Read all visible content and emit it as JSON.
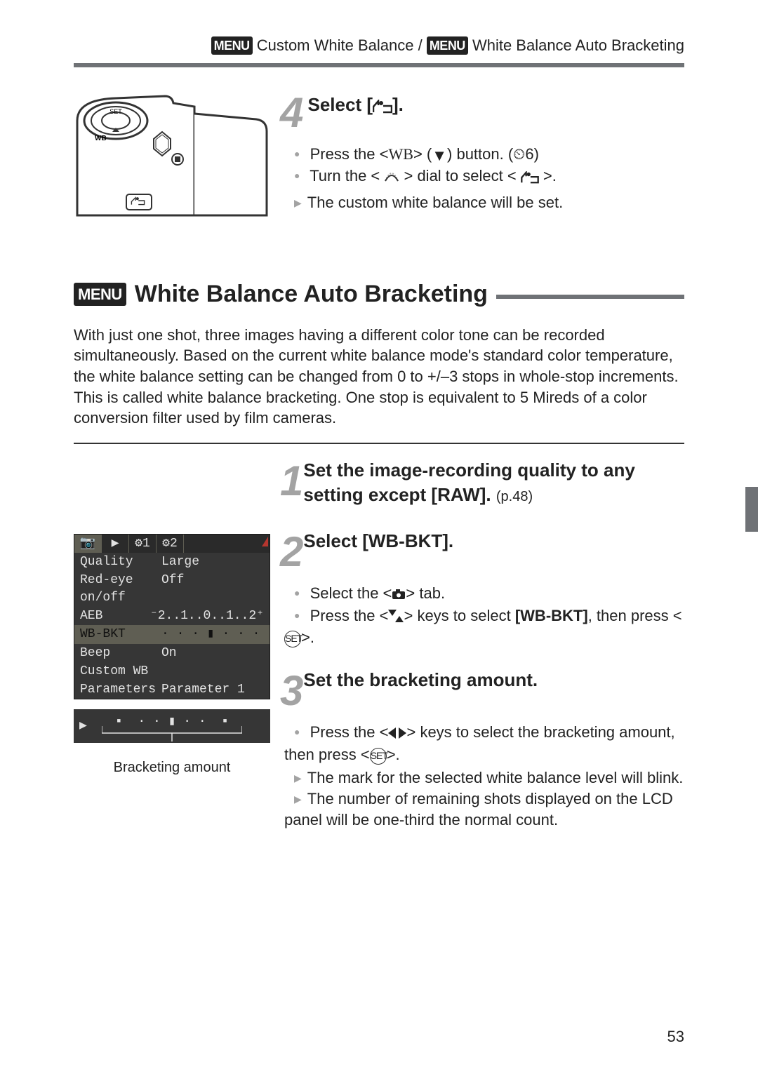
{
  "header": {
    "left": "Custom White Balance",
    "sep": " / ",
    "right": "White Balance Auto Bracketing"
  },
  "step4": {
    "num": "4",
    "title_prefix": "Select  [",
    "title_suffix": "].",
    "b1_a": "Press the <",
    "b1_wb": "WB",
    "b1_b": "> (",
    "b1_c": ") button. (",
    "b1_timer": "⏲6",
    "b1_d": ")",
    "b2_a": "Turn the < ",
    "b2_b": " > dial to select < ",
    "b2_c": " >.",
    "t1": "The custom white balance will be set."
  },
  "section": {
    "title": "White Balance Auto Bracketing"
  },
  "intro": "With just one shot, three images having a different color tone can be recorded simultaneously. Based on the current white balance mode's standard color temperature, the white balance setting can be changed from 0 to +/–3 stops in whole-stop increments. This is called white balance bracketing. One stop is equivalent to 5 Mireds of a color conversion filter used by film cameras.",
  "lcd": {
    "tabs": [
      "📷",
      "▶",
      "⚙1",
      "⚙2"
    ],
    "rows": [
      {
        "k": "Quality",
        "v": "Large"
      },
      {
        "k": "Red-eye on/off",
        "v": "Off"
      },
      {
        "k": "AEB",
        "v": "⁻2..1..0..1..2⁺"
      },
      {
        "k": "WB-BKT",
        "v": "· · · ▮ · · ·"
      },
      {
        "k": "Beep",
        "v": "On"
      },
      {
        "k": "Custom WB",
        "v": ""
      },
      {
        "k": "Parameters",
        "v": "Parameter 1"
      }
    ],
    "strip": "· · · ▮ · · ·",
    "caption": "Bracketing amount"
  },
  "steps": {
    "s1": {
      "num": "1",
      "title": "Set the image-recording quality to any setting except [RAW]. ",
      "ref": "(p.48)"
    },
    "s2": {
      "num": "2",
      "title": "Select [WB-BKT].",
      "b1_a": "Select the <",
      "b1_b": "> tab.",
      "b2_a": "Press the <",
      "b2_b": "> keys to select ",
      "b2_bold": "[WB-BKT]",
      "b2_c": ", then press <",
      "b2_d": ">."
    },
    "s3": {
      "num": "3",
      "title": "Set the bracketing amount.",
      "b1_a": "Press the <",
      "b1_b": "> keys to select the bracketing amount, then press <",
      "b1_c": ">.",
      "t1": "The mark for the selected white balance level will blink.",
      "t2": "The number of remaining shots displayed on the LCD panel will be one-third the normal count."
    }
  },
  "page": "53"
}
